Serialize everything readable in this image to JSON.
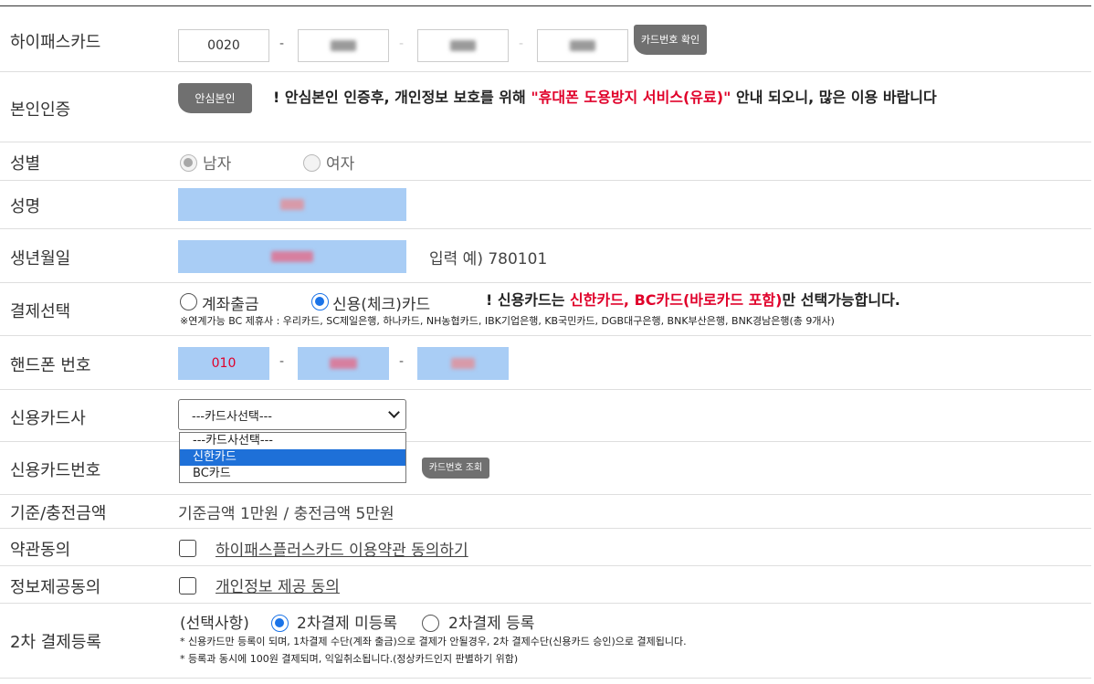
{
  "hipass": {
    "label": "하이패스카드",
    "part1": "0020",
    "button": "카드번호 확인"
  },
  "auth": {
    "label": "본인인증",
    "button": "안심본인",
    "notice_prefix": "! 안심본인 인증후, 개인정보 보호를 위해",
    "notice_highlight": "\"휴대폰 도용방지 서비스(유료)\"",
    "notice_suffix": "안내 되오니, 많은 이용 바랍니다"
  },
  "gender": {
    "label": "성별",
    "male": "남자",
    "female": "여자",
    "selected": "male"
  },
  "name": {
    "label": "성명"
  },
  "birth": {
    "label": "생년월일",
    "hint": "입력 예) 780101"
  },
  "payment": {
    "label": "결제선택",
    "option_account": "계좌출금",
    "option_credit": "신용(체크)카드",
    "selected": "credit",
    "notice_prefix": "! 신용카드는",
    "notice_highlight": "신한카드, BC카드(바로카드 포함)",
    "notice_suffix": "만 선택가능합니다.",
    "partners": "※연계가능 BC 제휴사 : 우리카드, SC제일은행, 하나카드, NH농협카드, IBK기업은행, KB국민카드, DGB대구은행, BNK부산은행, BNK경남은행(총 9개사)"
  },
  "phone": {
    "label": "핸드폰 번호",
    "prefix": "010"
  },
  "card_company": {
    "label": "신용카드사",
    "selected": "---카드사선택---",
    "options": [
      "---카드사선택---",
      "신한카드",
      "BC카드"
    ],
    "highlighted_index": 1
  },
  "card_number": {
    "label": "신용카드번호",
    "button": "카드번호 조회"
  },
  "amount": {
    "label": "기준/충전금액",
    "value": "기준금액 1만원 / 충전금액 5만원"
  },
  "terms": {
    "label": "약관동의",
    "link": "하이패스플러스카드 이용약관 동의하기"
  },
  "privacy": {
    "label": "정보제공동의",
    "link": "개인정보 제공 동의"
  },
  "second_payment": {
    "label": "2차 결제등록",
    "optional": "(선택사항)",
    "option_no": "2차결제 미등록",
    "option_yes": "2차결제 등록",
    "selected": "no",
    "note1": "* 신용카드만 등록이 되며, 1차결제 수단(계좌 출금)으로 결제가 안될경우, 2차 결제수단(신용카드 승인)으로 결제됩니다.",
    "note2": "* 등록과 동시에 100원 결제되며, 익일취소됩니다.(정상카드인지 판별하기 위함)"
  },
  "colors": {
    "input_fill": "#a9cdf5",
    "notice_red": "#e0002a",
    "radio_blue": "#1a73e8",
    "dropdown_highlight": "#1e70d8",
    "button_gray": "#707070"
  }
}
